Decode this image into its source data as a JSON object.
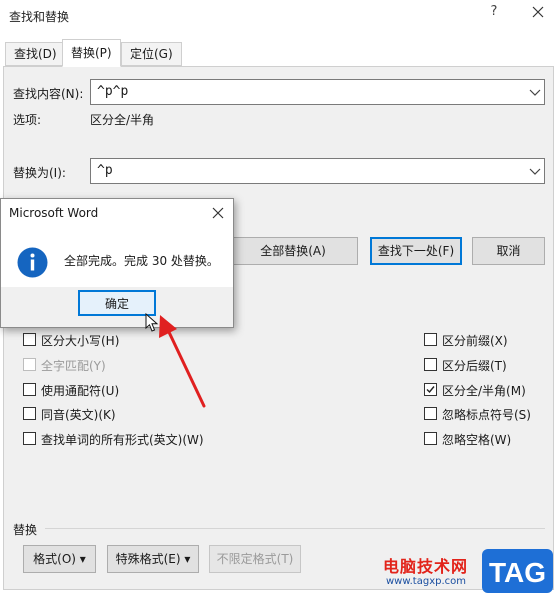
{
  "window": {
    "title": "查找和替换",
    "help": "?"
  },
  "tabs": [
    {
      "label": "查找(D)",
      "active": false
    },
    {
      "label": "替换(P)",
      "active": true
    },
    {
      "label": "定位(G)",
      "active": false
    }
  ],
  "find": {
    "label": "查找内容(N):",
    "value": "^p^p",
    "options_label": "选项:",
    "options_value": "区分全/半角"
  },
  "replace": {
    "label": "替换为(I):",
    "value": "^p"
  },
  "buttons": {
    "replace_all": "全部替换(A)",
    "find_next": "查找下一处(F)",
    "cancel": "取消"
  },
  "checkboxes_left": [
    {
      "label": "区分大小写(H)",
      "checked": false,
      "disabled": false
    },
    {
      "label": "全字匹配(Y)",
      "checked": false,
      "disabled": true
    },
    {
      "label": "使用通配符(U)",
      "checked": false,
      "disabled": false
    },
    {
      "label": "同音(英文)(K)",
      "checked": false,
      "disabled": false
    },
    {
      "label": "查找单词的所有形式(英文)(W)",
      "checked": false,
      "disabled": false
    }
  ],
  "checkboxes_right": [
    {
      "label": "区分前缀(X)",
      "checked": false
    },
    {
      "label": "区分后缀(T)",
      "checked": false
    },
    {
      "label": "区分全/半角(M)",
      "checked": true
    },
    {
      "label": "忽略标点符号(S)",
      "checked": false
    },
    {
      "label": "忽略空格(W)",
      "checked": false
    }
  ],
  "replace_section": {
    "heading": "替换",
    "format": "格式(O) ▾",
    "special": "特殊格式(E) ▾",
    "no_format": "不限定格式(T)"
  },
  "message_box": {
    "title": "Microsoft Word",
    "text": "全部完成。完成 30 处替换。",
    "ok": "确定"
  },
  "watermark": {
    "text": "电脑技术网",
    "url": "www.tagxp.com",
    "tag": "TAG"
  },
  "colors": {
    "accent": "#0078d7",
    "annotation": "#e02020",
    "tag_blue": "#1e6fd6"
  }
}
